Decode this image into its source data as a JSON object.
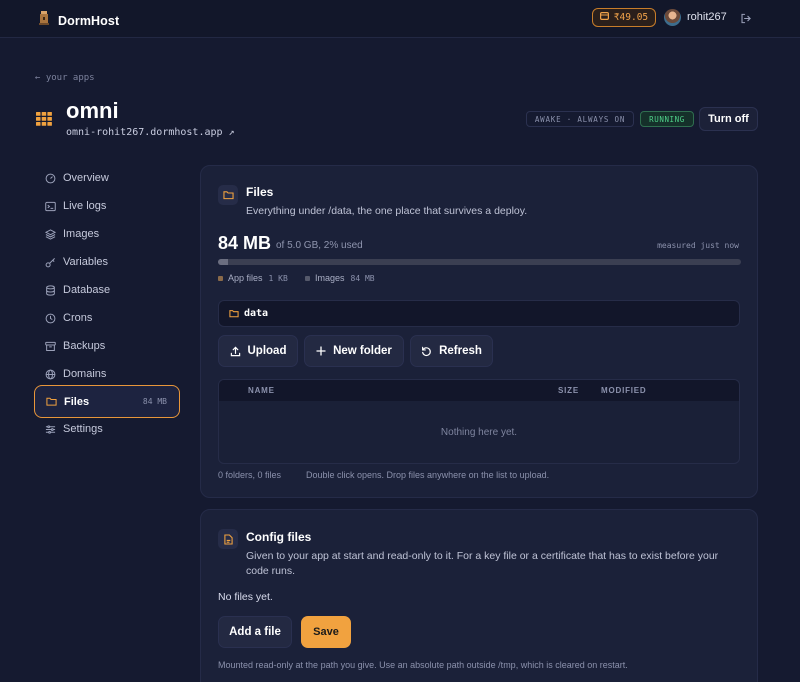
{
  "brand": {
    "name": "DormHost"
  },
  "topbar": {
    "credit": "₹49.05",
    "username": "rohit267"
  },
  "header": {
    "back": "← your apps",
    "app_name": "omni",
    "app_url": "omni-rohit267.dormhost.app ↗",
    "status_mode": "AWAKE · ALWAYS ON",
    "status_state": "RUNNING",
    "turn_off": "Turn off"
  },
  "sidebar": {
    "items": [
      {
        "label": "Overview",
        "icon": "gauge-icon"
      },
      {
        "label": "Live logs",
        "icon": "terminal-icon"
      },
      {
        "label": "Images",
        "icon": "layers-icon"
      },
      {
        "label": "Variables",
        "icon": "key-icon"
      },
      {
        "label": "Database",
        "icon": "database-icon"
      },
      {
        "label": "Crons",
        "icon": "clock-icon"
      },
      {
        "label": "Backups",
        "icon": "archive-icon"
      },
      {
        "label": "Domains",
        "icon": "globe-icon"
      },
      {
        "label": "Files",
        "icon": "folder-icon",
        "badge": "84 MB",
        "active": true
      },
      {
        "label": "Settings",
        "icon": "sliders-icon"
      }
    ]
  },
  "files": {
    "title": "Files",
    "description": "Everything under /data, the one place that survives a deploy.",
    "usage": "84 MB",
    "usage_of": "of 5.0 GB, 2% used",
    "usage_fraction": 0.02,
    "measured": "measured just now",
    "legend": [
      {
        "label": "App files",
        "value": "1 KB",
        "color": "#8a6a4a"
      },
      {
        "label": "Images",
        "value": "84 MB",
        "color": "#55596b"
      }
    ],
    "path": "data",
    "buttons": {
      "upload": "Upload",
      "new_folder": "New folder",
      "refresh": "Refresh"
    },
    "table": {
      "columns": {
        "name": "NAME",
        "size": "SIZE",
        "modified": "MODIFIED"
      },
      "empty": "Nothing here yet."
    },
    "counts": "0 folders, 0 files",
    "hint": "Double click opens. Drop files anywhere on the list to upload."
  },
  "config": {
    "title": "Config files",
    "description_line1": "Given to your app at start and read-only to it. For a key file or a certificate that has to exist before your",
    "description_line2": "code runs.",
    "no_files": "No files yet.",
    "add_file": "Add a file",
    "save": "Save",
    "note": "Mounted read-only at the path you give. Use an absolute path outside /tmp, which is cleared on restart."
  },
  "colors": {
    "accent": "#f1a23f",
    "running": "#4fd28a",
    "background": "#151a30"
  }
}
